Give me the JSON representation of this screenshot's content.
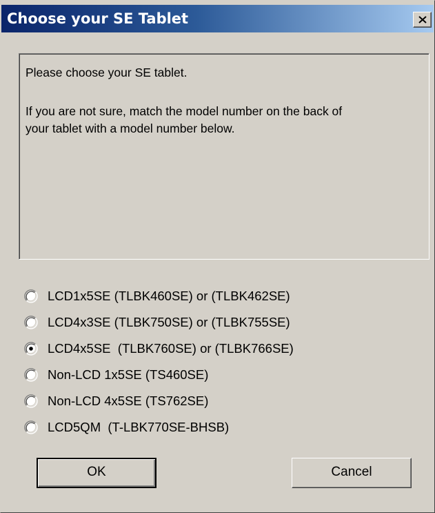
{
  "window": {
    "title": "Choose your SE Tablet",
    "close_glyph": "×"
  },
  "info": {
    "line1": "Please choose your SE tablet.",
    "line2": "If you are not sure, match the model number on the back of",
    "line3": "your tablet with a model number below."
  },
  "options": [
    {
      "label": "LCD1x5SE (TLBK460SE) or (TLBK462SE)",
      "selected": false
    },
    {
      "label": "LCD4x3SE (TLBK750SE) or (TLBK755SE)",
      "selected": false
    },
    {
      "label": "LCD4x5SE  (TLBK760SE) or (TLBK766SE)",
      "selected": true
    },
    {
      "label": "Non-LCD 1x5SE (TS460SE)",
      "selected": false
    },
    {
      "label": "Non-LCD 4x5SE (TS762SE)",
      "selected": false
    },
    {
      "label": "LCD5QM  (T-LBK770SE-BHSB)",
      "selected": false
    }
  ],
  "buttons": {
    "ok": "OK",
    "cancel": "Cancel"
  },
  "colors": {
    "face": "#d4d0c8",
    "title_start": "#0a246a",
    "title_end": "#a6caf0"
  }
}
